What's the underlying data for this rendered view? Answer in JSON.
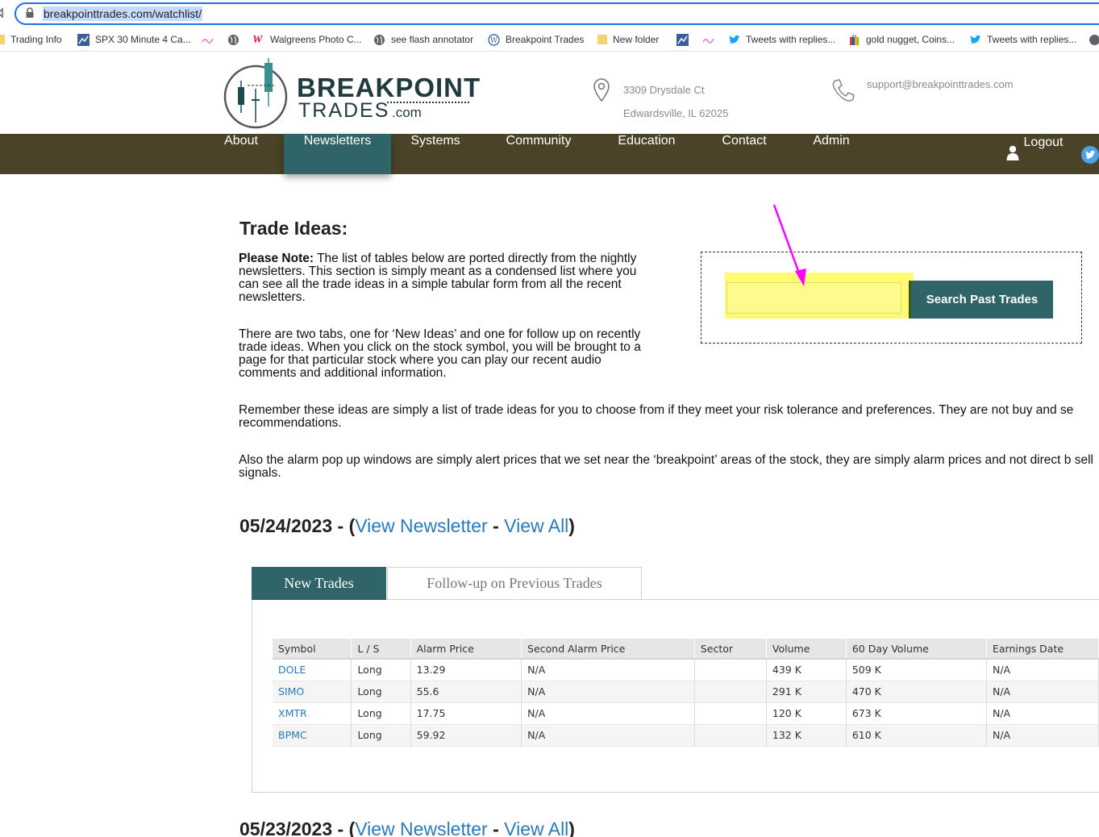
{
  "browser": {
    "url": "breakpointtrades.com/watchlist/",
    "bookmarks": [
      {
        "label": "Trading Info",
        "icon": "folder-icon"
      },
      {
        "label": "SPX 30 Minute 4 Ca...",
        "icon": "chart-favicon"
      },
      {
        "label": "",
        "icon": "pink-squiggle-favicon"
      },
      {
        "label": "",
        "icon": "globe-icon"
      },
      {
        "label": "Walgreens Photo C...",
        "icon": "walgreens-favicon"
      },
      {
        "label": "see flash annotator",
        "icon": "globe-icon"
      },
      {
        "label": "Breakpoint Trades",
        "icon": "wordpress-favicon"
      },
      {
        "label": "New folder",
        "icon": "folder-icon"
      },
      {
        "label": "",
        "icon": "chart-favicon"
      },
      {
        "label": "",
        "icon": "pink-squiggle-favicon"
      },
      {
        "label": "Tweets with replies...",
        "icon": "twitter-favicon"
      },
      {
        "label": "gold nugget, Coins...",
        "icon": "shopping-bag-favicon"
      },
      {
        "label": "Tweets with replies...",
        "icon": "twitter-favicon"
      }
    ]
  },
  "header": {
    "logo_line1": "BREAKPOINT",
    "logo_line2": "TRADES",
    "logo_suffix": ".com",
    "address_line1": "3309 Drysdale Ct",
    "address_line2": "Edwardsville, IL 62025",
    "email": "support@breakpointtrades.com"
  },
  "nav": {
    "items": [
      "About",
      "Newsletters",
      "Systems",
      "Community",
      "Education",
      "Contact",
      "Admin"
    ],
    "active": "Newsletters",
    "logout": "Logout",
    "colors": {
      "bar": "#4a4328",
      "active": "#2f6469"
    }
  },
  "main": {
    "title": "Trade Ideas:",
    "note_label": "Please Note:",
    "note_text": " The list of tables below are ported directly from the nightly newsletters.  This section is simply meant as a condensed list where you can see all the trade ideas in a simple tabular form from all the recent newsletters.",
    "tabs_text": "There are two tabs, one for ‘New Ideas’ and one for follow up on recently trade ideas. When you click on the stock symbol, you will be brought to a page for that particular stock where you can play our recent audio comments and additional information.",
    "remember_text": "Remember these ideas are simply a list of trade ideas for you to choose from if they meet your risk tolerance and preferences. They are not buy and se recommendations.",
    "alarm_text": "Also the alarm pop up windows are simply alert prices that we set near the ‘breakpoint’ areas of the stock, they are simply alarm prices and not direct b sell signals.",
    "search": {
      "value": "",
      "placeholder": "",
      "button": "Search Past Trades"
    }
  },
  "newsletters": [
    {
      "date": "05/24/2023",
      "view_newsletter": "View Newsletter",
      "view_all": "View All",
      "tabs": [
        "New Trades",
        "Follow-up on Previous Trades"
      ],
      "active_tab": "New Trades",
      "columns": [
        "Symbol",
        "L / S",
        "Alarm Price",
        "Second Alarm Price",
        "Sector",
        "Volume",
        "60 Day Volume",
        "Earnings Date"
      ],
      "rows": [
        [
          "DOLE",
          "Long",
          "13.29",
          "N/A",
          "",
          "439 K",
          "509 K",
          "N/A"
        ],
        [
          "SIMO",
          "Long",
          "55.6",
          "N/A",
          "",
          "291 K",
          "470 K",
          "N/A"
        ],
        [
          "XMTR",
          "Long",
          "17.75",
          "N/A",
          "",
          "120 K",
          "673 K",
          "N/A"
        ],
        [
          "BPMC",
          "Long",
          "59.92",
          "N/A",
          "",
          "132 K",
          "610 K",
          "N/A"
        ]
      ]
    },
    {
      "date": "05/23/2023",
      "view_newsletter": "View Newsletter",
      "view_all": "View All"
    }
  ],
  "annotation": {
    "highlight_color": "#fffb73",
    "arrow_color": "#ff00ff"
  }
}
